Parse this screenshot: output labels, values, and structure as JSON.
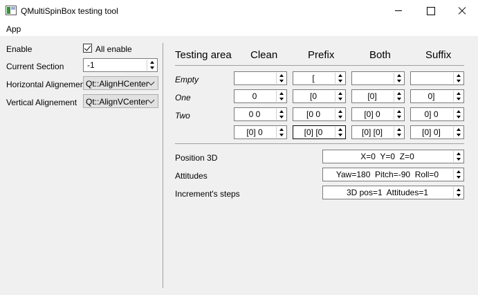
{
  "window": {
    "title": "QMultiSpinBox testing tool"
  },
  "menu": {
    "app": "App"
  },
  "left": {
    "enable_label": "Enable",
    "all_enable_label": "All enable",
    "current_section_label": "Current Section",
    "current_section_value": "-1",
    "halign_label": "Horizontal Alignement",
    "halign_value": "Qt::AlignHCenter",
    "valign_label": "Vertical Alignement",
    "valign_value": "Qt::AlignVCenter"
  },
  "grid": {
    "headers": {
      "testing_area": "Testing area",
      "clean": "Clean",
      "prefix": "Prefix",
      "both": "Both",
      "suffix": "Suffix"
    },
    "rows": [
      {
        "label": "Empty",
        "clean": "",
        "prefix": "[",
        "both": "",
        "suffix": ""
      },
      {
        "label": "One",
        "clean": "0",
        "prefix": "[0",
        "both": "[0]",
        "suffix": "0]"
      },
      {
        "label": "Two",
        "clean": "0 0",
        "prefix": "[0 0",
        "both": "[0] 0",
        "suffix": "0] 0"
      },
      {
        "label": "",
        "clean": "[0] 0",
        "prefix": "[0] [0",
        "both": "[0] [0]",
        "suffix": "[0] 0]"
      }
    ]
  },
  "bottom": {
    "position_label": "Position 3D",
    "position_value": "X=0  Y=0  Z=0",
    "attitudes_label": "Attitudes",
    "attitudes_value": "Yaw=180  Pitch=-90  Roll=0",
    "increment_label": "Increment's steps",
    "increment_value": "3D pos=1  Attitudes=1"
  }
}
